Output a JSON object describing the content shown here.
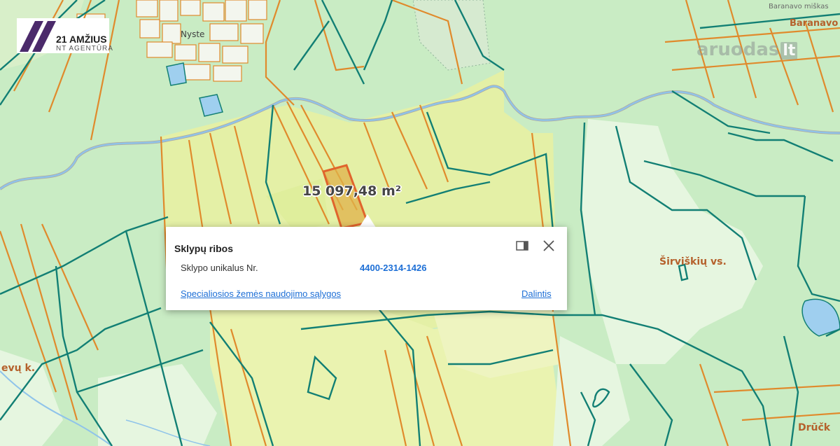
{
  "logo": {
    "name": "21 AMŽIUS",
    "subtitle": "NT AGENTŪRA"
  },
  "watermark": {
    "name": "aruodas",
    "tld": "lt"
  },
  "map": {
    "colors": {
      "forest": "#c9ecc4",
      "farmland": "#e6f39b",
      "selected_parcel": "#e0b24a",
      "parcel_border_green": "#127f74",
      "parcel_border_orange": "#e08a2c",
      "river": "#8fc3ea"
    },
    "place_labels": [
      "Baranavo",
      "Baranavo miškas",
      "Nyste",
      "Širviškių vs.",
      "Drūčk",
      "evų k."
    ],
    "area_label": "15 097,48 m²"
  },
  "popup": {
    "title": "Sklypų ribos",
    "rows": [
      {
        "key": "Sklypo unikalus Nr.",
        "value": "4400-2314-1426"
      }
    ],
    "link_conditions": "Specialiosios žemės naudojimo sąlygos",
    "link_share": "Dalintis",
    "icons": {
      "dock": "dock-icon",
      "close": "close-icon"
    }
  }
}
